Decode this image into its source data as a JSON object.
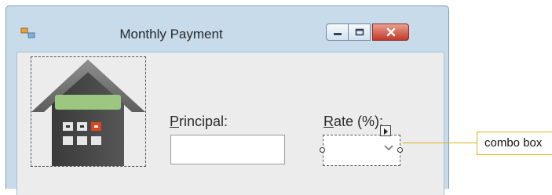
{
  "window": {
    "title": "Monthly Payment",
    "icon": "form-icon"
  },
  "caption_buttons": {
    "minimize": "minimize-icon",
    "maximize": "maximize-icon",
    "close": "close-icon"
  },
  "form": {
    "principal_label_accel": "P",
    "principal_label_rest": "rincipal:",
    "rate_label_accel": "R",
    "rate_label_rest": "ate (%):",
    "principal_value": "",
    "rate_value": ""
  },
  "picture": {
    "icon": "house-calculator-icon"
  },
  "annotation": {
    "text": "combo box"
  },
  "colors": {
    "window_frame": "#c7dbeb",
    "client_area": "#ececec",
    "close_button": "#c0392b",
    "callout_border": "#d8b31e"
  }
}
